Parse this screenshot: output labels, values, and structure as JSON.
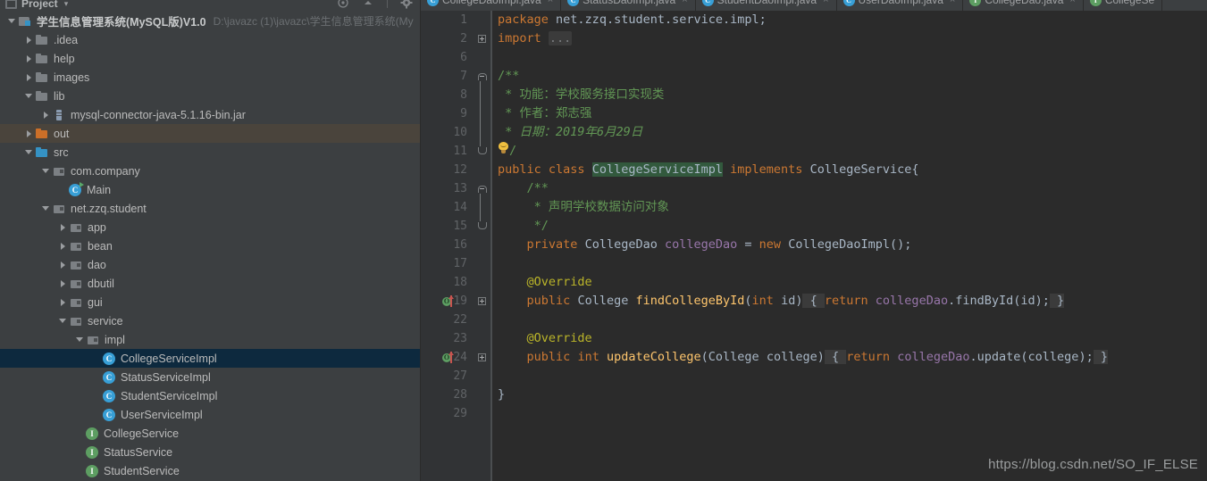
{
  "panel": {
    "title": "Project",
    "caret": "▾",
    "tools": [
      {
        "name": "locate-icon",
        "glyph": "target"
      },
      {
        "name": "collapse-all-icon",
        "glyph": "caret-up"
      },
      {
        "name": "settings-gear-icon",
        "glyph": "gear"
      }
    ]
  },
  "tree": [
    {
      "indent": 0,
      "arrow": "down",
      "icon": "module",
      "label": "学生信息管理系统(MySQL版)V1.0",
      "bold": true,
      "path": "D:\\javazc (1)\\javazc\\学生信息管理系统(My",
      "name": "project-root"
    },
    {
      "indent": 1,
      "arrow": "right",
      "icon": "folder",
      "label": ".idea",
      "name": "folder-idea"
    },
    {
      "indent": 1,
      "arrow": "right",
      "icon": "folder",
      "label": "help",
      "name": "folder-help"
    },
    {
      "indent": 1,
      "arrow": "right",
      "icon": "folder",
      "label": "images",
      "name": "folder-images"
    },
    {
      "indent": 1,
      "arrow": "down",
      "icon": "folder",
      "label": "lib",
      "name": "folder-lib"
    },
    {
      "indent": 2,
      "arrow": "right",
      "icon": "jar",
      "label": "mysql-connector-java-5.1.16-bin.jar",
      "name": "jar-mysql-connector"
    },
    {
      "indent": 1,
      "arrow": "right",
      "icon": "folder-orange",
      "label": "out",
      "name": "folder-out",
      "rowstate": "hover"
    },
    {
      "indent": 1,
      "arrow": "down",
      "icon": "folder-blue",
      "label": "src",
      "name": "folder-src"
    },
    {
      "indent": 2,
      "arrow": "down",
      "icon": "pkg",
      "label": "com.company",
      "name": "package-com-company"
    },
    {
      "indent": 3,
      "arrow": "none",
      "icon": "cls-run",
      "label": "Main",
      "name": "class-main"
    },
    {
      "indent": 2,
      "arrow": "down",
      "icon": "pkg",
      "label": "net.zzq.student",
      "name": "package-net-zzq-student"
    },
    {
      "indent": 3,
      "arrow": "right",
      "icon": "pkg",
      "label": "app",
      "name": "package-app"
    },
    {
      "indent": 3,
      "arrow": "right",
      "icon": "pkg",
      "label": "bean",
      "name": "package-bean"
    },
    {
      "indent": 3,
      "arrow": "right",
      "icon": "pkg",
      "label": "dao",
      "name": "package-dao"
    },
    {
      "indent": 3,
      "arrow": "right",
      "icon": "pkg",
      "label": "dbutil",
      "name": "package-dbutil"
    },
    {
      "indent": 3,
      "arrow": "right",
      "icon": "pkg",
      "label": "gui",
      "name": "package-gui"
    },
    {
      "indent": 3,
      "arrow": "down",
      "icon": "pkg",
      "label": "service",
      "name": "package-service"
    },
    {
      "indent": 4,
      "arrow": "down",
      "icon": "pkg",
      "label": "impl",
      "name": "package-impl"
    },
    {
      "indent": 5,
      "arrow": "none",
      "icon": "cls",
      "label": "CollegeServiceImpl",
      "name": "class-collegeserviceimpl",
      "rowstate": "selected"
    },
    {
      "indent": 5,
      "arrow": "none",
      "icon": "cls",
      "label": "StatusServiceImpl",
      "name": "class-statusserviceimpl"
    },
    {
      "indent": 5,
      "arrow": "none",
      "icon": "cls",
      "label": "StudentServiceImpl",
      "name": "class-studentserviceimpl"
    },
    {
      "indent": 5,
      "arrow": "none",
      "icon": "cls",
      "label": "UserServiceImpl",
      "name": "class-userserviceimpl"
    },
    {
      "indent": 4,
      "arrow": "none",
      "icon": "iface",
      "label": "CollegeService",
      "name": "interface-collegeservice"
    },
    {
      "indent": 4,
      "arrow": "none",
      "icon": "iface",
      "label": "StatusService",
      "name": "interface-statusservice"
    },
    {
      "indent": 4,
      "arrow": "none",
      "icon": "iface",
      "label": "StudentService",
      "name": "interface-studentservice"
    }
  ],
  "tabs": [
    {
      "label": "CollegeDaoImpl.java",
      "icon": "class",
      "active": false,
      "name": "tab-collegedaoimpl"
    },
    {
      "label": "StatusDaoImpl.java",
      "icon": "class",
      "active": false,
      "name": "tab-statusdaoimpl"
    },
    {
      "label": "StudentDaoImpl.java",
      "icon": "class",
      "active": false,
      "name": "tab-studentdaoimpl"
    },
    {
      "label": "UserDaoImpl.java",
      "icon": "class",
      "active": false,
      "name": "tab-userdaoimpl"
    },
    {
      "label": "CollegeDao.java",
      "icon": "interface",
      "active": false,
      "name": "tab-collegedao"
    },
    {
      "label": "CollegeSe",
      "icon": "interface",
      "active": false,
      "name": "tab-collegeservice"
    }
  ],
  "editor": {
    "close_glyph": "×",
    "lines": [
      {
        "no": "1",
        "gutter": null,
        "fold": null,
        "name": "code-line-1"
      },
      {
        "no": "2",
        "gutter": null,
        "fold": "plus",
        "name": "code-line-2"
      },
      {
        "no": "6",
        "gutter": null,
        "fold": null,
        "name": "code-line-6"
      },
      {
        "no": "7",
        "gutter": null,
        "fold": "top",
        "name": "code-line-7"
      },
      {
        "no": "8",
        "gutter": null,
        "fold": null,
        "name": "code-line-8"
      },
      {
        "no": "9",
        "gutter": null,
        "fold": null,
        "name": "code-line-9"
      },
      {
        "no": "10",
        "gutter": null,
        "fold": null,
        "name": "code-line-10"
      },
      {
        "no": "11",
        "gutter": null,
        "fold": "bottom",
        "name": "code-line-11"
      },
      {
        "no": "12",
        "gutter": null,
        "fold": null,
        "name": "code-line-12"
      },
      {
        "no": "13",
        "gutter": null,
        "fold": "top",
        "name": "code-line-13"
      },
      {
        "no": "14",
        "gutter": null,
        "fold": null,
        "name": "code-line-14"
      },
      {
        "no": "15",
        "gutter": null,
        "fold": "bottom",
        "name": "code-line-15"
      },
      {
        "no": "16",
        "gutter": null,
        "fold": null,
        "name": "code-line-16"
      },
      {
        "no": "17",
        "gutter": null,
        "fold": null,
        "name": "code-line-17"
      },
      {
        "no": "18",
        "gutter": null,
        "fold": null,
        "name": "code-line-18"
      },
      {
        "no": "19",
        "gutter": "implements",
        "fold": "plus",
        "name": "code-line-19"
      },
      {
        "no": "22",
        "gutter": null,
        "fold": null,
        "name": "code-line-22"
      },
      {
        "no": "23",
        "gutter": null,
        "fold": null,
        "name": "code-line-23"
      },
      {
        "no": "24",
        "gutter": "implements",
        "fold": "plus",
        "name": "code-line-24"
      },
      {
        "no": "27",
        "gutter": null,
        "fold": null,
        "name": "code-line-27"
      },
      {
        "no": "28",
        "gutter": null,
        "fold": null,
        "name": "code-line-28"
      },
      {
        "no": "29",
        "gutter": null,
        "fold": null,
        "name": "code-line-29"
      }
    ],
    "source": {
      "l1": "package net.zzq.student.service.impl;",
      "l2": "import ...",
      "l7": "/**",
      "l8": " * 功能：学校服务接口实现类",
      "l9": " * 作者：郑志强",
      "l10": " * 日期：2019年6月29日",
      "l11": " */",
      "l12": "public class CollegeServiceImpl implements CollegeService{",
      "l13": "    /**",
      "l14": "     * 声明学校数据访问对象",
      "l15": "     */",
      "l16": "    private CollegeDao collegeDao = new CollegeDaoImpl();",
      "l18": "    @Override",
      "l19": "    public College findCollegeById(int id) { return collegeDao.findById(id); }",
      "l23": "    @Override",
      "l24": "    public int updateCollege(College college) { return collegeDao.update(college); }",
      "l28": "}"
    }
  },
  "watermark": "https://blog.csdn.net/SO_IF_ELSE",
  "colors": {
    "panel_bg": "#3c3f41",
    "editor_bg": "#2b2b2b",
    "gutter_bg": "#313335",
    "selection": "#0d293e",
    "keyword": "#cc7832",
    "comment": "#629755",
    "method": "#ffc66d",
    "field": "#9876aa",
    "annotation": "#bbb529",
    "number": "#6897bb",
    "class_highlight": "#32593d"
  }
}
